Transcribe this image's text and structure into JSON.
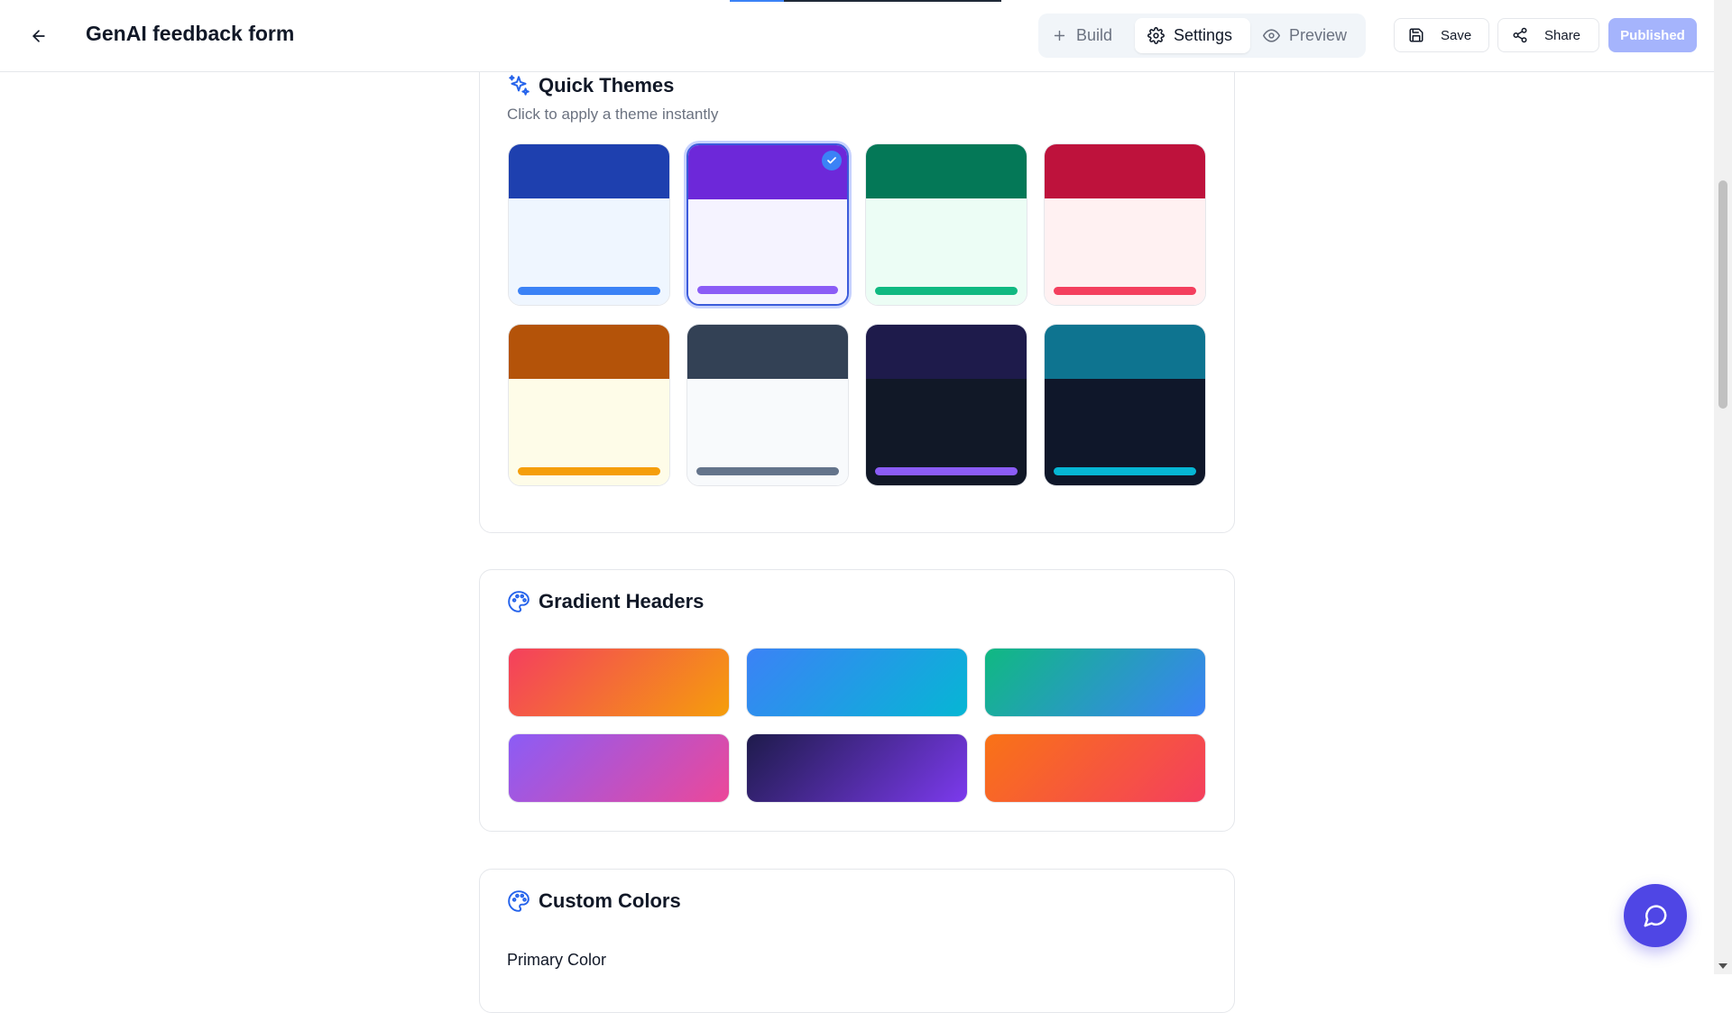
{
  "header": {
    "title": "GenAI feedback form",
    "progress_fraction": 0.2,
    "modes": [
      {
        "label": "Build",
        "icon": "plus-icon"
      },
      {
        "label": "Settings",
        "icon": "gear-icon",
        "active": true
      },
      {
        "label": "Preview",
        "icon": "eye-icon"
      }
    ],
    "save_label": "Save",
    "share_label": "Share",
    "published_label": "Published"
  },
  "quick_themes": {
    "title": "Quick Themes",
    "subtitle": "Click to apply a theme instantly",
    "selected_index": 1,
    "themes": [
      {
        "header": "#1e40af",
        "body": "#eff6ff",
        "accent": "#3b82f6"
      },
      {
        "header": "#6d28d9",
        "body": "#f5f3ff",
        "accent": "#8b5cf6"
      },
      {
        "header": "#047857",
        "body": "#ecfdf5",
        "accent": "#10b981"
      },
      {
        "header": "#be123c",
        "body": "#fff1f2",
        "accent": "#f43f5e"
      },
      {
        "header": "#b45309",
        "body": "#fefce8",
        "accent": "#f59e0b"
      },
      {
        "header": "#334155",
        "body": "#f8fafc",
        "accent": "#64748b"
      },
      {
        "header": "#1e1b4b",
        "body": "#111827",
        "accent": "#8b5cf6"
      },
      {
        "header": "#0e7490",
        "body": "#0f172a",
        "accent": "#06b6d4"
      }
    ]
  },
  "gradient_headers": {
    "title": "Gradient Headers",
    "gradients": [
      {
        "from": "#f43f5e",
        "to": "#f59e0b"
      },
      {
        "from": "#3b82f6",
        "to": "#06b6d4"
      },
      {
        "from": "#10b981",
        "to": "#3b82f6"
      },
      {
        "from": "#8b5cf6",
        "to": "#ec4899"
      },
      {
        "from": "#1e1b4b",
        "to": "#7c3aed"
      },
      {
        "from": "#f97316",
        "to": "#f43f5e"
      }
    ]
  },
  "custom_colors": {
    "title": "Custom Colors",
    "primary_label": "Primary Color"
  },
  "colors": {
    "brand": "#4f46e5",
    "published_bg": "#a5b4fc",
    "icon_accent": "#2563eb"
  }
}
